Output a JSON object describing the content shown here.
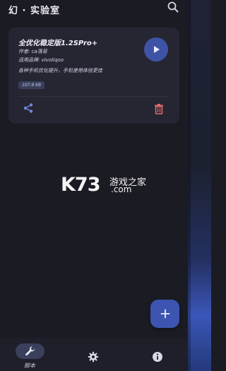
{
  "header": {
    "title": "幻 · 实验室",
    "search_icon": "search-icon"
  },
  "card": {
    "title": "全优化稳定版1.2SPro+",
    "author": "作者: ca落易",
    "device": "适用品牌: vivoliqoo",
    "description": "各种手机优化提升，手机使用体验更佳",
    "size": "107.8 KB",
    "play_icon": "play-icon",
    "share_icon": "share-icon",
    "delete_icon": "delete-icon",
    "delete_color": "#e26d6d"
  },
  "fab": {
    "icon": "add-icon"
  },
  "watermark": {
    "brand": "K73",
    "text": "游戏之家",
    "domain": ".com"
  },
  "bottom_nav": {
    "items": [
      {
        "label": "脚本",
        "icon": "wrench-icon",
        "active": true
      },
      {
        "label": "",
        "icon": "gear-icon",
        "active": false
      },
      {
        "label": "",
        "icon": "info-icon",
        "active": false
      }
    ]
  },
  "colors": {
    "background": "#1b1b24",
    "card": "#262633",
    "accent": "#3f53a6",
    "nav_pill": "#3a3f5c"
  }
}
